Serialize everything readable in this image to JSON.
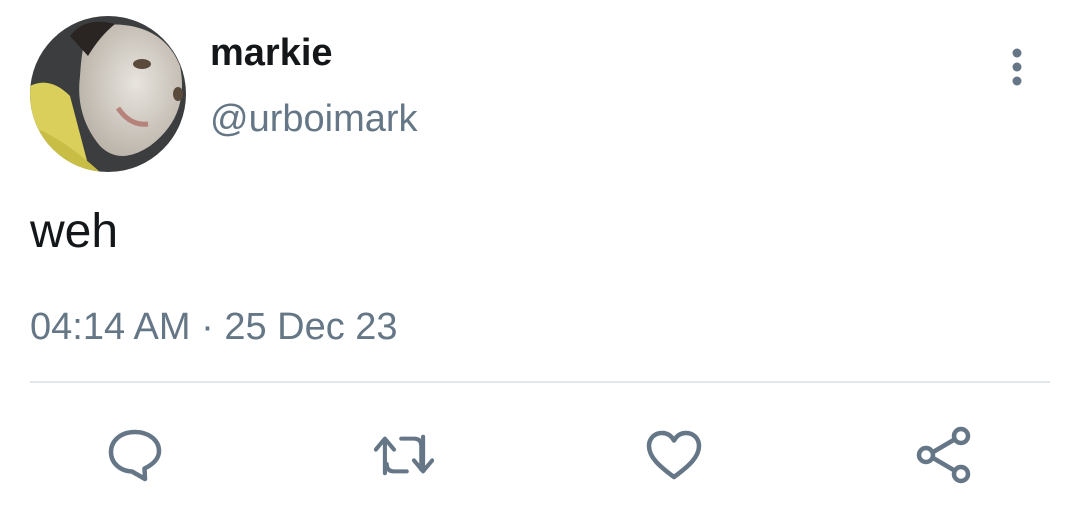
{
  "tweet": {
    "display_name": "markie",
    "handle": "@urboimark",
    "text": "weh",
    "time": "04:14 AM",
    "separator": "·",
    "date": "25 Dec 23"
  },
  "icons": {
    "more": "more-vertical-icon",
    "reply": "reply-icon",
    "retweet": "retweet-icon",
    "like": "heart-icon",
    "share": "share-icon"
  },
  "colors": {
    "text_primary": "#14171a",
    "text_secondary": "#657786",
    "divider": "#e1e8ed",
    "icon": "#657786"
  }
}
